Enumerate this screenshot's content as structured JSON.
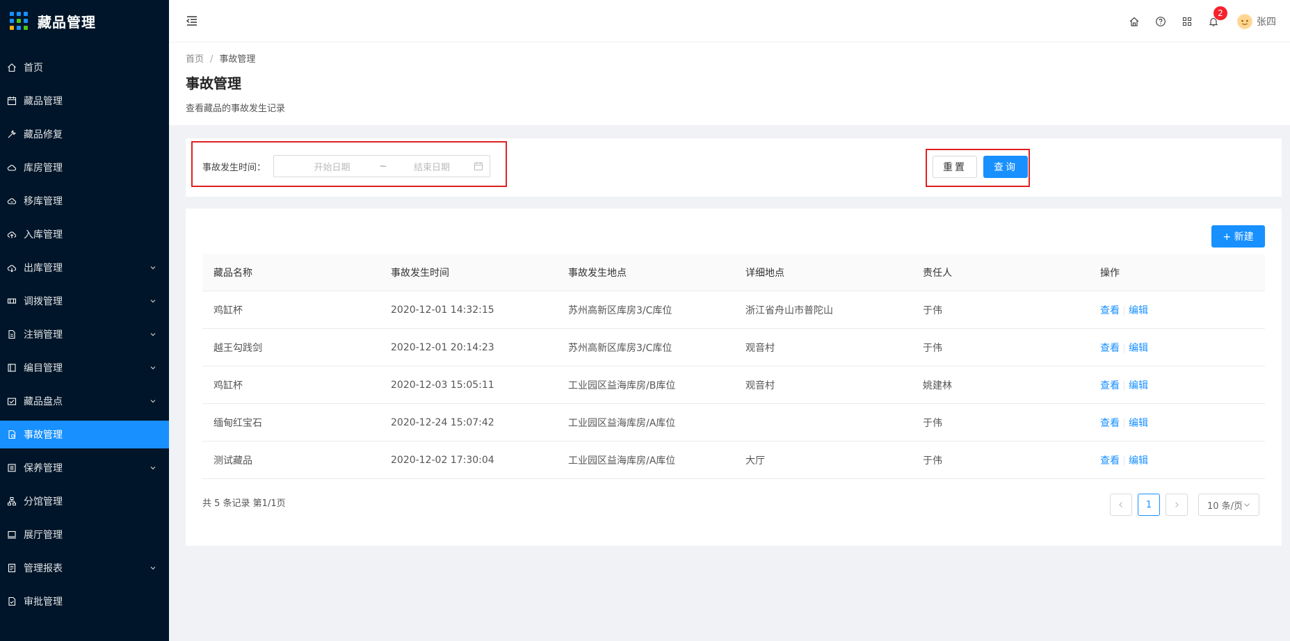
{
  "app": {
    "title": "藏品管理"
  },
  "sidebar": {
    "items": [
      {
        "label": "首页",
        "icon": "home-icon",
        "has_arrow": false
      },
      {
        "label": "藏品管理",
        "icon": "calendar-icon",
        "has_arrow": false
      },
      {
        "label": "藏品修复",
        "icon": "wrench-icon",
        "has_arrow": false
      },
      {
        "label": "库房管理",
        "icon": "cloud-icon",
        "has_arrow": false
      },
      {
        "label": "移库管理",
        "icon": "cloud-move-icon",
        "has_arrow": false
      },
      {
        "label": "入库管理",
        "icon": "cloud-upload-icon",
        "has_arrow": false
      },
      {
        "label": "出库管理",
        "icon": "cloud-download-icon",
        "has_arrow": true
      },
      {
        "label": "调拨管理",
        "icon": "transfer-icon",
        "has_arrow": true
      },
      {
        "label": "注销管理",
        "icon": "file-icon",
        "has_arrow": true
      },
      {
        "label": "编目管理",
        "icon": "catalog-icon",
        "has_arrow": true
      },
      {
        "label": "藏品盘点",
        "icon": "inventory-icon",
        "has_arrow": true
      },
      {
        "label": "事故管理",
        "icon": "accident-icon",
        "has_arrow": false,
        "active": true
      },
      {
        "label": "保养管理",
        "icon": "maintenance-icon",
        "has_arrow": true
      },
      {
        "label": "分馆管理",
        "icon": "branch-icon",
        "has_arrow": false
      },
      {
        "label": "展厅管理",
        "icon": "hall-icon",
        "has_arrow": false
      },
      {
        "label": "管理报表",
        "icon": "report-icon",
        "has_arrow": true
      },
      {
        "label": "审批管理",
        "icon": "approval-icon",
        "has_arrow": false
      }
    ]
  },
  "header": {
    "notification_count": "2",
    "user_name": "张四"
  },
  "breadcrumb": {
    "home": "首页",
    "sep": "/",
    "current": "事故管理"
  },
  "page": {
    "title": "事故管理",
    "description": "查看藏品的事故发生记录"
  },
  "search": {
    "label": "事故发生时间：",
    "start_placeholder": "开始日期",
    "tilde": "~",
    "end_placeholder": "结束日期",
    "reset_label": "重置",
    "query_label": "查询"
  },
  "table": {
    "new_label": "+ 新建",
    "columns": [
      "藏品名称",
      "事故发生时间",
      "事故发生地点",
      "详细地点",
      "责任人",
      "操作"
    ],
    "rows": [
      {
        "name": "鸡缸杯",
        "time": "2020-12-01 14:32:15",
        "place": "苏州高新区库房3/C库位",
        "detail": "浙江省舟山市普陀山",
        "person": "于伟"
      },
      {
        "name": "越王勾践剑",
        "time": "2020-12-01 20:14:23",
        "place": "苏州高新区库房3/C库位",
        "detail": "观音村",
        "person": "于伟"
      },
      {
        "name": "鸡缸杯",
        "time": "2020-12-03 15:05:11",
        "place": "工业园区益海库房/B库位",
        "detail": "观音村",
        "person": "姚建林"
      },
      {
        "name": "缅甸红宝石",
        "time": "2020-12-24 15:07:42",
        "place": "工业园区益海库房/A库位",
        "detail": "",
        "person": "于伟"
      },
      {
        "name": "测试藏品",
        "time": "2020-12-02 17:30:04",
        "place": "工业园区益海库房/A库位",
        "detail": "大厅",
        "person": "于伟"
      }
    ],
    "action_view": "查看",
    "action_edit": "编辑"
  },
  "pagination": {
    "total_text": "共 5 条记录 第1/1页",
    "current_page": "1",
    "page_size": "10 条/页"
  },
  "colors": {
    "sidebar_bg": "#001529",
    "primary": "#1890ff",
    "highlight_border": "#e02020"
  }
}
